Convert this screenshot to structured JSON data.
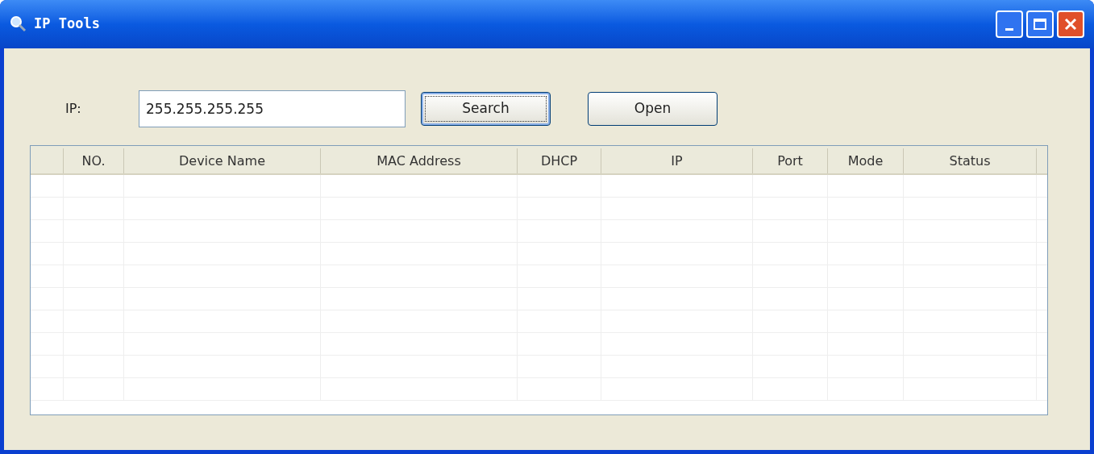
{
  "window": {
    "title": "IP Tools"
  },
  "ip_field": {
    "label": "IP:",
    "value": "255.255.255.255"
  },
  "buttons": [
    {
      "label": "Search",
      "focused": true
    },
    {
      "label": "Open",
      "focused": false
    }
  ],
  "table": {
    "columns": [
      "NO.",
      "Device Name",
      "MAC Address",
      "DHCP",
      "IP",
      "Port",
      "Mode",
      "Status"
    ]
  }
}
